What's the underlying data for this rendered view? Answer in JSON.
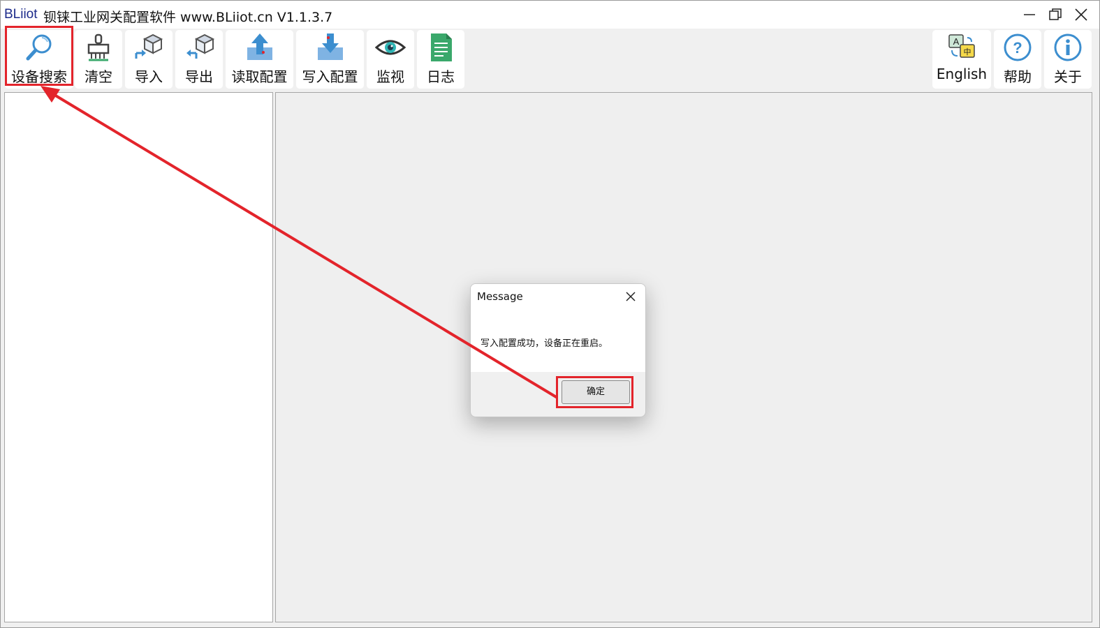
{
  "window": {
    "brand": "BLiiot",
    "title": "钡铼工业网关配置软件 www.BLiiot.cn V1.1.3.7"
  },
  "toolbar": {
    "left": [
      {
        "label": "设备搜索",
        "icon": "magnifier-icon"
      },
      {
        "label": "清空",
        "icon": "broom-icon"
      },
      {
        "label": "导入",
        "icon": "import-box-icon"
      },
      {
        "label": "导出",
        "icon": "export-box-icon"
      },
      {
        "label": "读取配置",
        "icon": "upload-arrow-icon"
      },
      {
        "label": "写入配置",
        "icon": "download-arrow-icon"
      },
      {
        "label": "监视",
        "icon": "eye-icon"
      },
      {
        "label": "日志",
        "icon": "document-icon"
      }
    ],
    "right": [
      {
        "label": "English",
        "icon": "translate-icon"
      },
      {
        "label": "帮助",
        "icon": "help-icon"
      },
      {
        "label": "关于",
        "icon": "info-icon"
      }
    ]
  },
  "dialog": {
    "title": "Message",
    "message": "写入配置成功，设备正在重启。",
    "ok_label": "确定"
  },
  "colors": {
    "annotation": "#e3242b",
    "icon_blue": "#3c8ecf",
    "icon_green": "#3aa86b",
    "toolbar_bg": "#f0f0f0"
  }
}
